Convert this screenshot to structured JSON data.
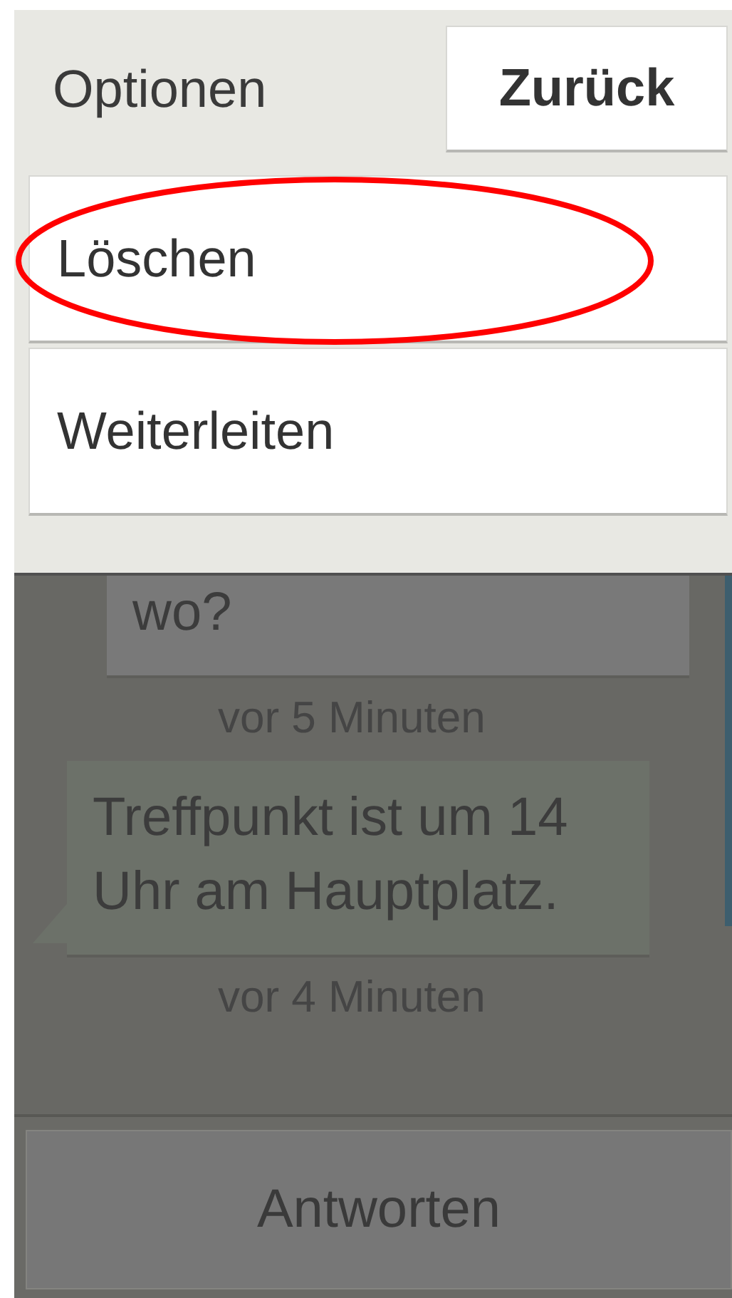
{
  "dialog": {
    "title": "Optionen",
    "back_button": "Zurück",
    "items": [
      {
        "label": "Löschen",
        "highlighted": true
      },
      {
        "label": "Weiterleiten",
        "highlighted": false
      }
    ]
  },
  "messages": [
    {
      "kind": "sent",
      "text": "wo?",
      "time": "vor 5 Minuten"
    },
    {
      "kind": "received",
      "text": "Treffpunkt ist um 14 Uhr am Hauptplatz.",
      "time": "vor 4 Minuten"
    }
  ],
  "reply_button": "Antworten"
}
